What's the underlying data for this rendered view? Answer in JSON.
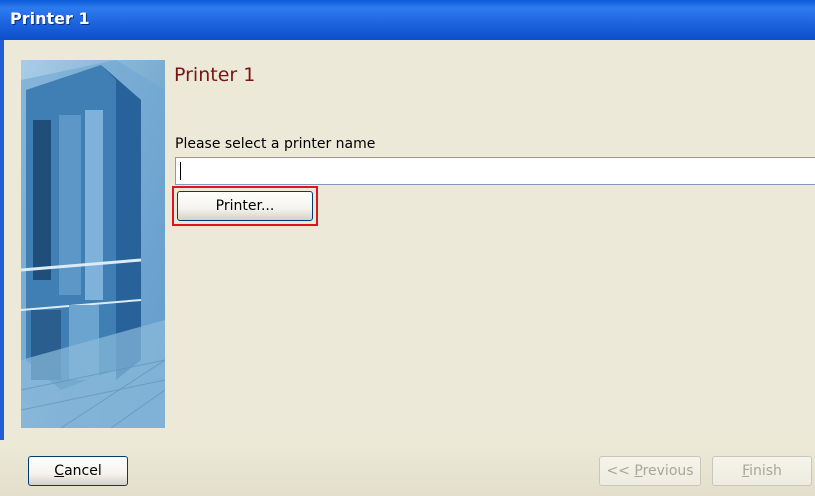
{
  "window": {
    "title": "Printer 1"
  },
  "content": {
    "heading": "Printer 1",
    "prompt": "Please select a printer name",
    "printer_name_value": "",
    "browse_button_label": "Printer..."
  },
  "footer": {
    "cancel_label_underlined": "C",
    "cancel_label_rest": "ancel",
    "previous_label_prefix": "<< ",
    "previous_label_underlined": "P",
    "previous_label_rest": "revious",
    "finish_label_underlined": "F",
    "finish_label_rest": "inish"
  },
  "colors": {
    "titlebar": "#1E66E0",
    "dialog_background": "#ECE9D8",
    "heading": "#7A1414",
    "highlight": "#E0141E"
  }
}
